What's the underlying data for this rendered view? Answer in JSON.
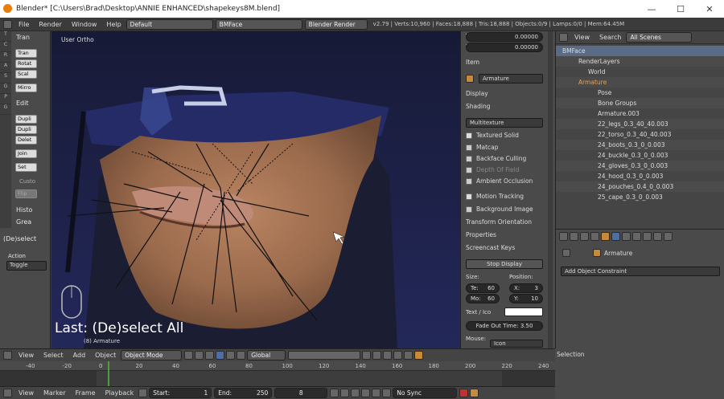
{
  "window": {
    "title": "Blender* [C:\\Users\\Brad\\Desktop\\ANNIE ENHANCED\\shapekeys8M.blend]",
    "min": "—",
    "max": "☐",
    "close": "✕"
  },
  "menu": {
    "items": [
      "File",
      "Render",
      "Window",
      "Help"
    ],
    "layout": "Default",
    "scene": "BMFace",
    "engine": "Blender Render",
    "stats": "v2.79 | Verts:10,960 | Faces:18,888 | Tris:18,888 | Objects:0/9 | Lamps:0/0 | Mem:64.45M"
  },
  "toolshelf": {
    "tabs": [
      "T",
      "C",
      "R",
      "A",
      "S",
      "G",
      "P",
      "G"
    ],
    "transform_header": "Tran",
    "transform_buttons": [
      "Tran",
      "Rotat",
      "Scal",
      "Mirro"
    ],
    "edit_header": "Edit",
    "edit_buttons": [
      "Dupli",
      "Dupli",
      "Delet",
      "Join",
      "Set"
    ],
    "custom_label": "Custo",
    "flip_label": "Flip",
    "history_header": "Histo",
    "grease_header": "Grea",
    "operator_header": "(De)select",
    "action_label": "Action",
    "action_value": "Toggle"
  },
  "viewport": {
    "view_label": "User Ortho",
    "last_op": "Last: (De)select All",
    "object_label": "(8) Armature"
  },
  "npanel": {
    "y_label": "Y:",
    "y_value": "0.00000",
    "z_label": "Z:",
    "z_value": "0.00000",
    "item_header": "Item",
    "item_name": "Armature",
    "display_header": "Display",
    "shading_header": "Shading",
    "shading_mode": "Multitexture",
    "textured_solid": "Textured Solid",
    "matcap": "Matcap",
    "backface": "Backface Culling",
    "depth": "Depth Of Field",
    "ao": "Ambient Occlusion",
    "motion": "Motion Tracking",
    "bg": "Background Image",
    "transform_orient": "Transform Orientation",
    "properties": "Properties",
    "screencast": "Screencast Keys",
    "stop_display": "Stop Display",
    "size_label": "Size:",
    "position_label": "Position:",
    "te_label": "Te:",
    "te_value": "60",
    "mo_label": "Mo:",
    "mo_value": "60",
    "x_label": "X:",
    "x_value": "3",
    "y2_label": "Y:",
    "y2_value": "10",
    "text_icon": "Text / Ico",
    "fade_out": "Fade Out Time: 3.50",
    "mouse_label": "Mouse:",
    "mouse_value": "Icon"
  },
  "outliner": {
    "view": "View",
    "search": "Search",
    "filter": "All Scenes",
    "rows": [
      "BMFace",
      "RenderLayers",
      "World",
      "Armature",
      "Pose",
      "Bone Groups",
      "Armature.003",
      "22_legs_0.3_40_40.003",
      "22_torso_0.3_40_40.003",
      "24_boots_0.3_0_0.003",
      "24_buckle_0.3_0_0.003",
      "24_gloves_0.3_0_0.003",
      "24_hood_0.3_0_0.003",
      "24_pouches_0.4_0_0.003",
      "25_cape_0.3_0_0.003"
    ]
  },
  "props": {
    "breadcrumb": "Armature",
    "add_constraint": "Add Object Constraint"
  },
  "vpheader": {
    "view": "View",
    "select": "Select",
    "add": "Add",
    "object": "Object",
    "mode": "Object Mode",
    "global": "Global"
  },
  "selection_label": "Selection",
  "timeline": {
    "ticks": [
      "-40",
      "-20",
      "0",
      "20",
      "40",
      "60",
      "80",
      "100",
      "120",
      "140",
      "160",
      "180",
      "200",
      "220",
      "240",
      "260"
    ],
    "current_frame": 2
  },
  "tlheader": {
    "view": "View",
    "marker": "Marker",
    "frame": "Frame",
    "playback": "Playback",
    "start_label": "Start:",
    "start": "1",
    "end_label": "End:",
    "end": "250",
    "current": "8",
    "sync": "No Sync"
  }
}
